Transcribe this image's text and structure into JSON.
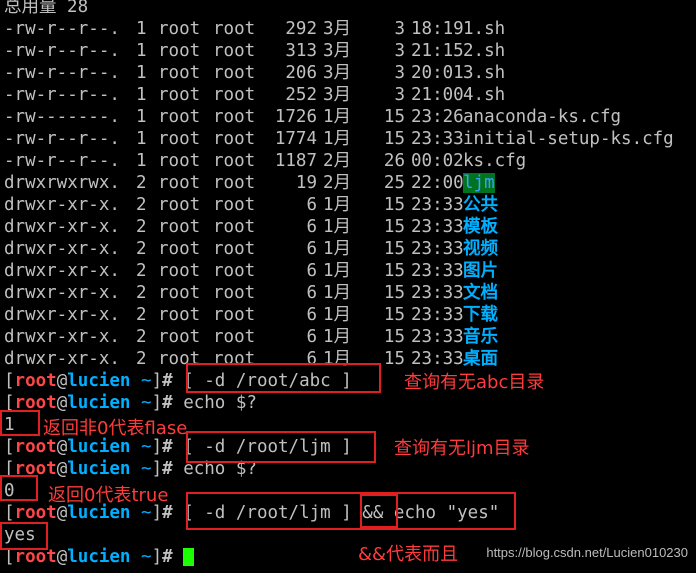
{
  "total_line": "总用量 28",
  "files": [
    {
      "perm": "-rw-r--r--.",
      "links": "1",
      "owner": "root",
      "group": "root",
      "size": "292",
      "month": "3月",
      "day": "3",
      "time": "18:19",
      "name": "1.sh",
      "kind": "file"
    },
    {
      "perm": "-rw-r--r--.",
      "links": "1",
      "owner": "root",
      "group": "root",
      "size": "313",
      "month": "3月",
      "day": "3",
      "time": "21:15",
      "name": "2.sh",
      "kind": "file"
    },
    {
      "perm": "-rw-r--r--.",
      "links": "1",
      "owner": "root",
      "group": "root",
      "size": "206",
      "month": "3月",
      "day": "3",
      "time": "20:01",
      "name": "3.sh",
      "kind": "file"
    },
    {
      "perm": "-rw-r--r--.",
      "links": "1",
      "owner": "root",
      "group": "root",
      "size": "252",
      "month": "3月",
      "day": "3",
      "time": "21:00",
      "name": "4.sh",
      "kind": "file"
    },
    {
      "perm": "-rw-------.",
      "links": "1",
      "owner": "root",
      "group": "root",
      "size": "1726",
      "month": "1月",
      "day": "15",
      "time": "23:26",
      "name": "anaconda-ks.cfg",
      "kind": "file"
    },
    {
      "perm": "-rw-r--r--.",
      "links": "1",
      "owner": "root",
      "group": "root",
      "size": "1774",
      "month": "1月",
      "day": "15",
      "time": "23:33",
      "name": "initial-setup-ks.cfg",
      "kind": "file"
    },
    {
      "perm": "-rw-r--r--.",
      "links": "1",
      "owner": "root",
      "group": "root",
      "size": "1187",
      "month": "2月",
      "day": "26",
      "time": "00:02",
      "name": "ks.cfg",
      "kind": "file"
    },
    {
      "perm": "drwxrwxrwx.",
      "links": "2",
      "owner": "root",
      "group": "root",
      "size": "19",
      "month": "2月",
      "day": "25",
      "time": "22:00",
      "name": "ljm",
      "kind": "sticky"
    },
    {
      "perm": "drwxr-xr-x.",
      "links": "2",
      "owner": "root",
      "group": "root",
      "size": "6",
      "month": "1月",
      "day": "15",
      "time": "23:33",
      "name": "公共",
      "kind": "dir"
    },
    {
      "perm": "drwxr-xr-x.",
      "links": "2",
      "owner": "root",
      "group": "root",
      "size": "6",
      "month": "1月",
      "day": "15",
      "time": "23:33",
      "name": "模板",
      "kind": "dir"
    },
    {
      "perm": "drwxr-xr-x.",
      "links": "2",
      "owner": "root",
      "group": "root",
      "size": "6",
      "month": "1月",
      "day": "15",
      "time": "23:33",
      "name": "视频",
      "kind": "dir"
    },
    {
      "perm": "drwxr-xr-x.",
      "links": "2",
      "owner": "root",
      "group": "root",
      "size": "6",
      "month": "1月",
      "day": "15",
      "time": "23:33",
      "name": "图片",
      "kind": "dir"
    },
    {
      "perm": "drwxr-xr-x.",
      "links": "2",
      "owner": "root",
      "group": "root",
      "size": "6",
      "month": "1月",
      "day": "15",
      "time": "23:33",
      "name": "文档",
      "kind": "dir"
    },
    {
      "perm": "drwxr-xr-x.",
      "links": "2",
      "owner": "root",
      "group": "root",
      "size": "6",
      "month": "1月",
      "day": "15",
      "time": "23:33",
      "name": "下载",
      "kind": "dir"
    },
    {
      "perm": "drwxr-xr-x.",
      "links": "2",
      "owner": "root",
      "group": "root",
      "size": "6",
      "month": "1月",
      "day": "15",
      "time": "23:33",
      "name": "音乐",
      "kind": "dir"
    },
    {
      "perm": "drwxr-xr-x.",
      "links": "2",
      "owner": "root",
      "group": "root",
      "size": "6",
      "month": "1月",
      "day": "15",
      "time": "23:33",
      "name": "桌面",
      "kind": "dir"
    }
  ],
  "prompt": {
    "open": "[",
    "user": "root",
    "at": "@",
    "host": "lucien",
    "tilde": "~",
    "close": "]",
    "hash": "#"
  },
  "session": [
    {
      "type": "prompt",
      "cmd": " [ -d /root/abc ]"
    },
    {
      "type": "prompt",
      "cmd": " echo $?"
    },
    {
      "type": "output",
      "text": "1"
    },
    {
      "type": "prompt",
      "cmd": " [ -d /root/ljm ]"
    },
    {
      "type": "prompt",
      "cmd": " echo $?"
    },
    {
      "type": "output",
      "text": "0"
    },
    {
      "type": "prompt",
      "cmd": " [ -d /root/ljm ] && echo \"yes\""
    },
    {
      "type": "output",
      "text": "yes"
    },
    {
      "type": "prompt",
      "cmd": " ",
      "cursor": true
    }
  ],
  "annotations": {
    "note_abc": "查询有无abc目录",
    "note_ret1": "返回非0代表flase",
    "note_ljm": "查询有无ljm目录",
    "note_ret0": "返回0代表true",
    "note_and": "&&代表而且"
  },
  "watermark": "https://blog.csdn.net/Lucien010230",
  "colors": {
    "background": "#000000",
    "text": "#c0c0c0",
    "dir": "#00afff",
    "user": "#ff4646",
    "highlight_bg": "#00731f",
    "annotation": "#e02020",
    "cursor": "#1cff00"
  }
}
